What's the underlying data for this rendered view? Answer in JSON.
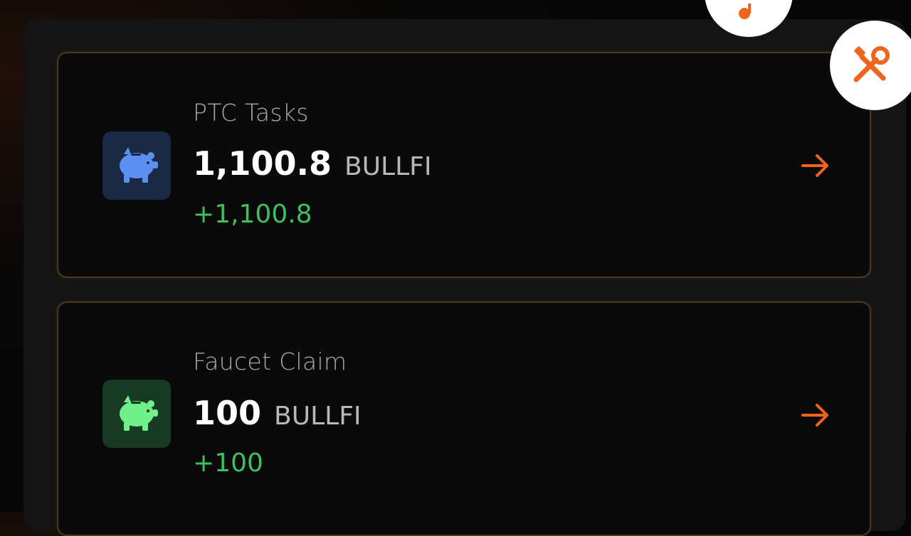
{
  "cards": [
    {
      "title": "PTC Tasks",
      "amount": "1,100.8",
      "unit": "BULLFI",
      "delta": "+1,100.8",
      "icon": "piggy-bank-icon",
      "icon_color": "#5b8ff0",
      "icon_bg": "#1b2a44"
    },
    {
      "title": "Faucet Claim",
      "amount": "100",
      "unit": "BULLFI",
      "delta": "+100",
      "icon": "piggy-bank-icon",
      "icon_color": "#6ff08a",
      "icon_bg": "#183a22"
    }
  ],
  "colors": {
    "accent": "#f0641e",
    "positive": "#3fbf5e",
    "card_border": "#4a3a1c"
  },
  "floating_buttons": [
    {
      "icon": "music-note-icon"
    },
    {
      "icon": "tools-icon"
    }
  ]
}
